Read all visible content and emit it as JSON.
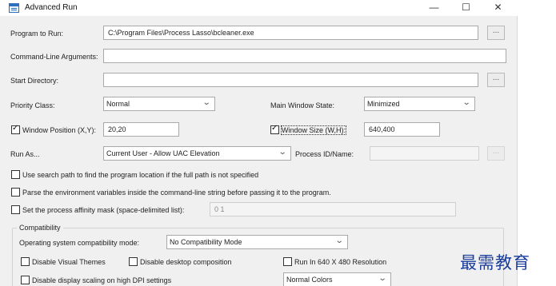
{
  "window": {
    "title": "Advanced Run",
    "minimize_glyph": "—",
    "maximize_glyph": "☐",
    "close_glyph": "✕"
  },
  "program": {
    "label": "Program to Run:",
    "value": "C:\\Program Files\\Process Lasso\\bcleaner.exe",
    "browse": "..."
  },
  "cmdline": {
    "label": "Command-Line Arguments:",
    "value": ""
  },
  "startdir": {
    "label": "Start Directory:",
    "value": "",
    "browse": "..."
  },
  "priority": {
    "label": "Priority Class:",
    "value": "Normal"
  },
  "main_window_state": {
    "label": "Main Window State:",
    "value": "Minimized"
  },
  "window_position": {
    "label": "Window Position (X,Y):",
    "checked": true,
    "value": "20,20"
  },
  "window_size": {
    "label": "Window Size (W,H):",
    "checked": true,
    "value": "640,400"
  },
  "run_as": {
    "label": "Run As...",
    "value": "Current User - Allow UAC Elevation"
  },
  "process_id": {
    "label": "Process ID/Name:",
    "value": "",
    "browse": "..."
  },
  "options": {
    "search_path": "Use search path to find the program location if the full path is not specified",
    "parse_env": "Parse the environment variables inside the command-line string before passing it to the program.",
    "affinity_label": "Set the process affinity mask (space-delimited list):",
    "affinity_value": "0 1"
  },
  "compat": {
    "title": "Compatibility",
    "mode_label": "Operating system compatibility mode:",
    "mode_value": "No Compatibility Mode",
    "disable_visual_themes": "Disable Visual Themes",
    "disable_desktop_composition": "Disable desktop composition",
    "run_640x480": "Run In 640 X 480 Resolution",
    "disable_dpi_scaling": "Disable display scaling on high DPI settings",
    "colors_value": "Normal Colors"
  },
  "watermark": "最需教育"
}
